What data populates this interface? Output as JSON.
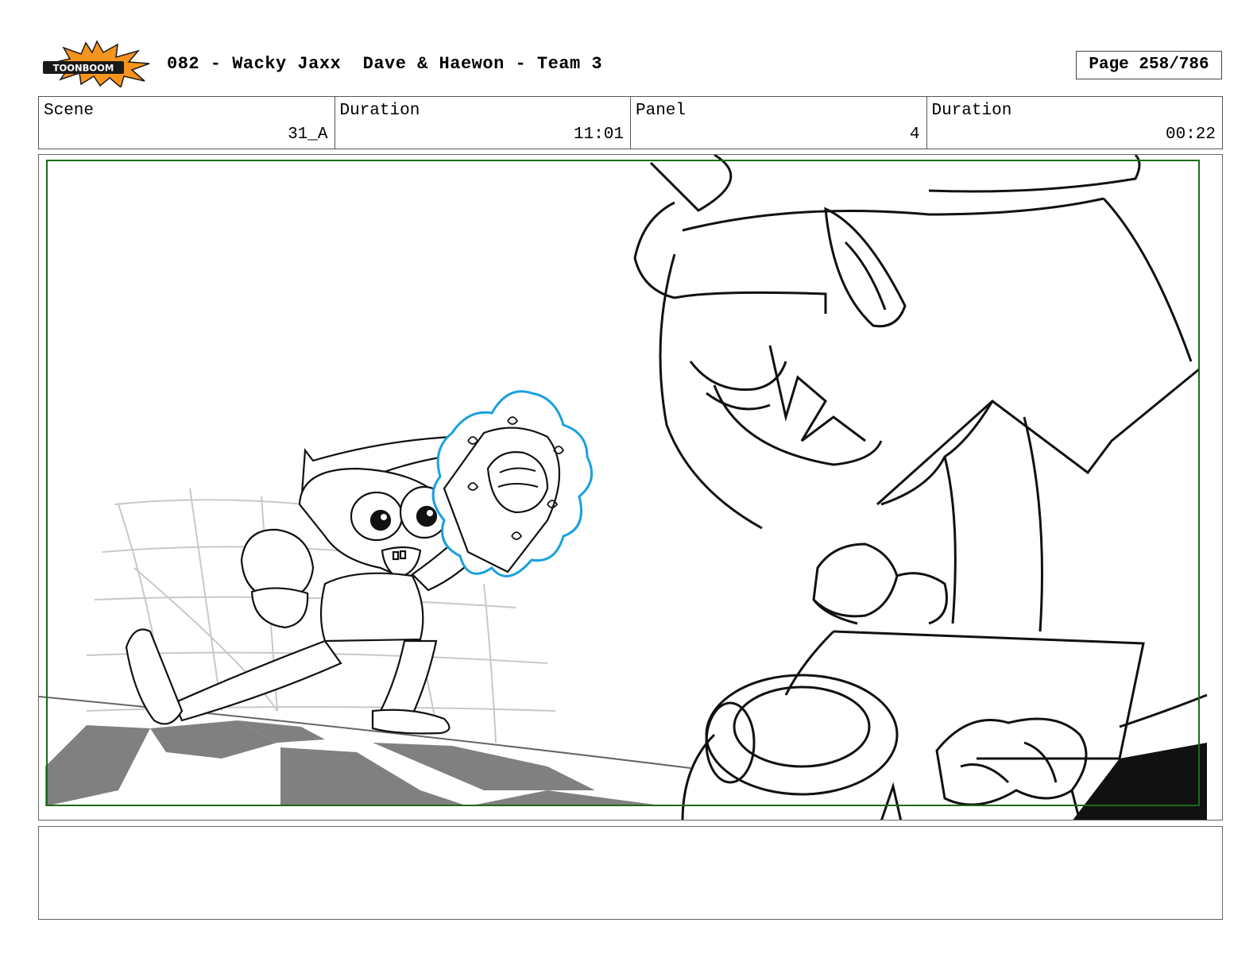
{
  "header": {
    "logo_text": "TOONBOOM",
    "title": "082 - Wacky Jaxx  Dave & Haewon - Team 3",
    "page_label": "Page 258/786"
  },
  "info": {
    "scene_label": "Scene",
    "scene_value": "31_A",
    "duration_label": "Duration",
    "duration_value": "11:01",
    "panel_label": "Panel",
    "panel_value": "4",
    "panel_duration_label": "Duration",
    "panel_duration_value": "00:22"
  },
  "panel": {
    "safe_frame_color": "#1a6b1a",
    "highlight_color": "#1aa0e0",
    "shadow_color": "#808080"
  },
  "notes": {
    "text": ""
  }
}
